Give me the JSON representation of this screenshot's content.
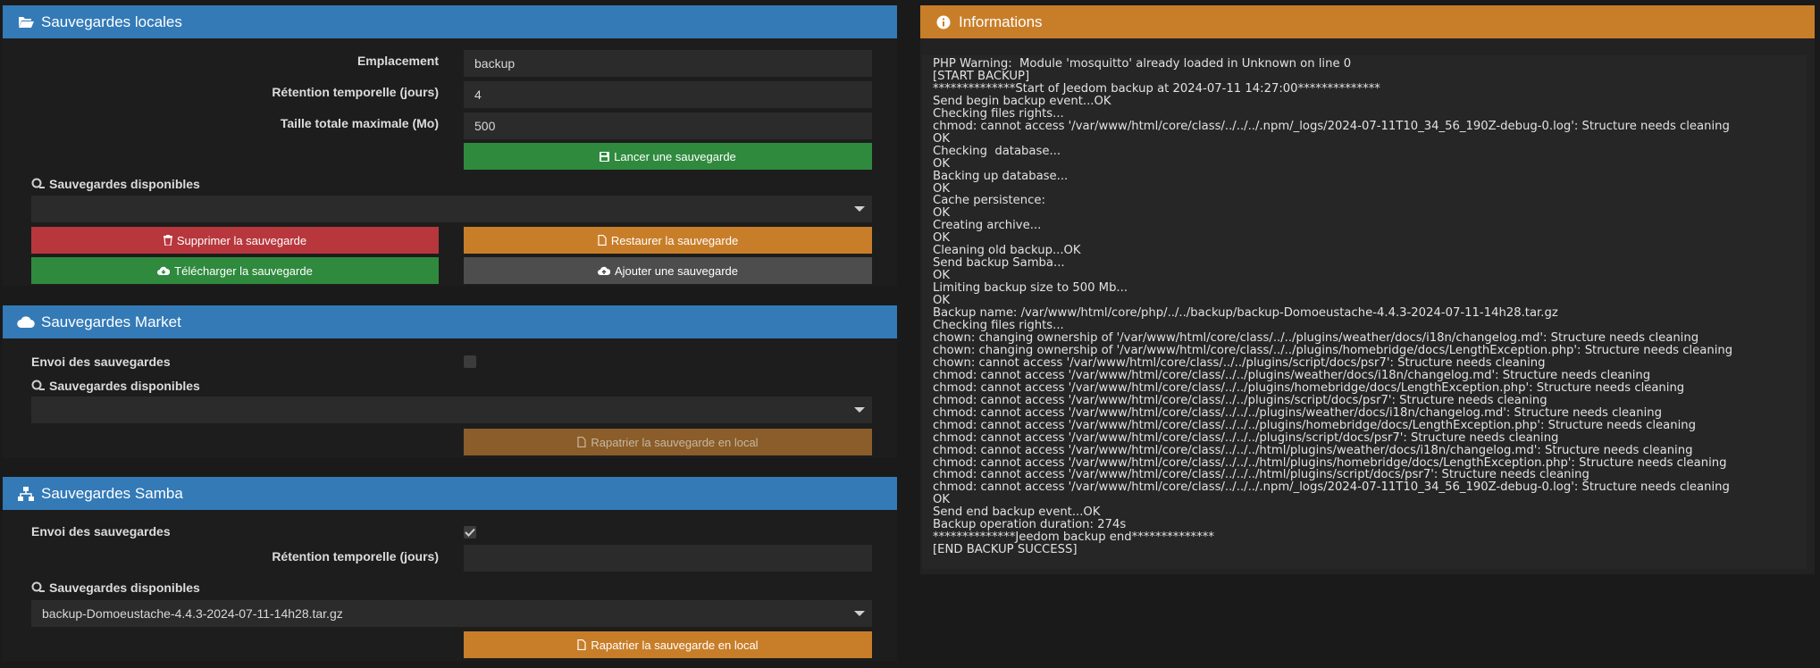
{
  "local": {
    "title": "Sauvegardes locales",
    "icon": "folder-open-icon",
    "location_label": "Emplacement",
    "location_value": "backup",
    "retention_label": "Rétention temporelle (jours)",
    "retention_value": "4",
    "max_size_label": "Taille totale maximale (Mo)",
    "max_size_value": "500",
    "launch_button": "Lancer une sauvegarde",
    "available_label": "Sauvegardes disponibles",
    "available_selected": "",
    "delete_button": "Supprimer la sauvegarde",
    "restore_button": "Restaurer la sauvegarde",
    "download_button": "Télécharger la sauvegarde",
    "add_button": "Ajouter une sauvegarde"
  },
  "market": {
    "title": "Sauvegardes Market",
    "icon": "cloud-icon",
    "send_label": "Envoi des sauvegardes",
    "send_checked": false,
    "available_label": "Sauvegardes disponibles",
    "available_selected": "",
    "fetch_button": "Rapatrier la sauvegarde en local"
  },
  "samba": {
    "title": "Sauvegardes Samba",
    "icon": "network-icon",
    "send_label": "Envoi des sauvegardes",
    "send_checked": true,
    "retention_label": "Rétention temporelle (jours)",
    "retention_value": "",
    "available_label": "Sauvegardes disponibles",
    "available_selected": "backup-Domoeustache-4.4.3-2024-07-11-14h28.tar.gz",
    "fetch_button": "Rapatrier la sauvegarde en local"
  },
  "info": {
    "title": "Informations",
    "icon": "info-circle-icon",
    "log": "PHP Warning:  Module 'mosquitto' already loaded in Unknown on line 0\n[START BACKUP]\n**************Start of Jeedom backup at 2024-07-11 14:27:00**************\nSend begin backup event...OK\nChecking files rights...\nchmod: cannot access '/var/www/html/core/class/../../../.npm/_logs/2024-07-11T10_34_56_190Z-debug-0.log': Structure needs cleaning\nOK\nChecking  database...\nOK\nBacking up database...\nOK\nCache persistence:\nOK\nCreating archive...\nOK\nCleaning old backup...OK\nSend backup Samba...\nOK\nLimiting backup size to 500 Mb...\nOK\nBackup name: /var/www/html/core/php/../../backup/backup-Domoeustache-4.4.3-2024-07-11-14h28.tar.gz\nChecking files rights...\nchown: changing ownership of '/var/www/html/core/class/../../plugins/weather/docs/i18n/changelog.md': Structure needs cleaning\nchown: changing ownership of '/var/www/html/core/class/../../plugins/homebridge/docs/LengthException.php': Structure needs cleaning\nchown: cannot access '/var/www/html/core/class/../../plugins/script/docs/psr7': Structure needs cleaning\nchmod: cannot access '/var/www/html/core/class/../../plugins/weather/docs/i18n/changelog.md': Structure needs cleaning\nchmod: cannot access '/var/www/html/core/class/../../plugins/homebridge/docs/LengthException.php': Structure needs cleaning\nchmod: cannot access '/var/www/html/core/class/../../plugins/script/docs/psr7': Structure needs cleaning\nchmod: cannot access '/var/www/html/core/class/../../../plugins/weather/docs/i18n/changelog.md': Structure needs cleaning\nchmod: cannot access '/var/www/html/core/class/../../../plugins/homebridge/docs/LengthException.php': Structure needs cleaning\nchmod: cannot access '/var/www/html/core/class/../../../plugins/script/docs/psr7': Structure needs cleaning\nchmod: cannot access '/var/www/html/core/class/../../../html/plugins/weather/docs/i18n/changelog.md': Structure needs cleaning\nchmod: cannot access '/var/www/html/core/class/../../../html/plugins/homebridge/docs/LengthException.php': Structure needs cleaning\nchmod: cannot access '/var/www/html/core/class/../../../html/plugins/script/docs/psr7': Structure needs cleaning\nchmod: cannot access '/var/www/html/core/class/../../../.npm/_logs/2024-07-11T10_34_56_190Z-debug-0.log': Structure needs cleaning\nOK\nSend end backup event...OK\nBackup operation duration: 274s\n**************Jeedom backup end**************\n[END BACKUP SUCCESS]"
  },
  "colors": {
    "header_blue": "#337ab7",
    "header_orange": "#c87e29",
    "btn_green": "#2f8a3e",
    "btn_red": "#b7373d",
    "btn_orange": "#c87e29",
    "btn_gray": "#4d4d4d"
  }
}
